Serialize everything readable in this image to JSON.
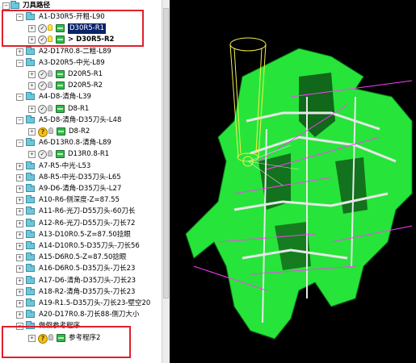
{
  "tree": {
    "root": "刀具路径",
    "items": [
      {
        "label": "A1-D30R5-开粗-L90",
        "level": 1,
        "exp": "−"
      },
      {
        "label": "D30R5-R1",
        "level": 2,
        "exp": "+",
        "icons": "bulb-on",
        "selected": true
      },
      {
        "label": "> D30R5-R2",
        "level": 2,
        "exp": "+",
        "icons": "bulb-on",
        "bold": true
      },
      {
        "label": "A2-D17R0.8-二粗-L89",
        "level": 1,
        "exp": "+"
      },
      {
        "label": "A3-D20R5-中光-L89",
        "level": 1,
        "exp": "−"
      },
      {
        "label": "D20R5-R1",
        "level": 2,
        "exp": "+",
        "icons": "bulb"
      },
      {
        "label": "D20R5-R2",
        "level": 2,
        "exp": "+",
        "icons": "bulb"
      },
      {
        "label": "A4-D8-清角-L39",
        "level": 1,
        "exp": "−"
      },
      {
        "label": "D8-R1",
        "level": 2,
        "exp": "+",
        "icons": "bulb"
      },
      {
        "label": "A5-D8-清角-D35刀头-L48",
        "level": 1,
        "exp": "−"
      },
      {
        "label": "D8-R2",
        "level": 2,
        "exp": "+",
        "icons": "q"
      },
      {
        "label": "A6-D13R0.8-清角-L89",
        "level": 1,
        "exp": "−"
      },
      {
        "label": "D13R0.8-R1",
        "level": 2,
        "exp": "+",
        "icons": "bulb"
      },
      {
        "label": "A7-R5-中光-L53",
        "level": 1,
        "exp": "+"
      },
      {
        "label": "A8-R5-中光-D35刀头-L65",
        "level": 1,
        "exp": "+"
      },
      {
        "label": "A9-D6-清角-D35刀头-L27",
        "level": 1,
        "exp": "+"
      },
      {
        "label": "A10-R6-侧深度-Z=87.55",
        "level": 1,
        "exp": "+"
      },
      {
        "label": "A11-R6-光刀-D55刀头-60刀长",
        "level": 1,
        "exp": "+"
      },
      {
        "label": "A12-R6-光刀-D55刀头-刀长72",
        "level": 1,
        "exp": "+"
      },
      {
        "label": "A13-D10R0.5-Z=87.50捻眼",
        "level": 1,
        "exp": "+"
      },
      {
        "label": "A14-D10R0.5-D35刀头-刀长56",
        "level": 1,
        "exp": "+"
      },
      {
        "label": "A15-D6R0.5-Z=87.50捻眼",
        "level": 1,
        "exp": "+"
      },
      {
        "label": "A16-D6R0.5-D35刀头-刀长23",
        "level": 1,
        "exp": "+"
      },
      {
        "label": "A17-D6-清角-D35刀头-刀长23",
        "level": 1,
        "exp": "+"
      },
      {
        "label": "A18-R2-清角-D35刀头-刀长23",
        "level": 1,
        "exp": "+"
      },
      {
        "label": "A19-R1.5-D35刀头-刀长23-壁空20",
        "level": 1,
        "exp": "+"
      },
      {
        "label": "A20-D17R0.8-刀长88-侧刀大小",
        "level": 1,
        "exp": "+"
      },
      {
        "label": "做假参考程序",
        "level": 1,
        "exp": "−"
      },
      {
        "label": "参考程序2",
        "level": 2,
        "exp": "+",
        "icons": "q"
      }
    ]
  },
  "colors": {
    "accent": "#e0202a",
    "toolpath": "#27e43a",
    "select": "#0a246a"
  }
}
